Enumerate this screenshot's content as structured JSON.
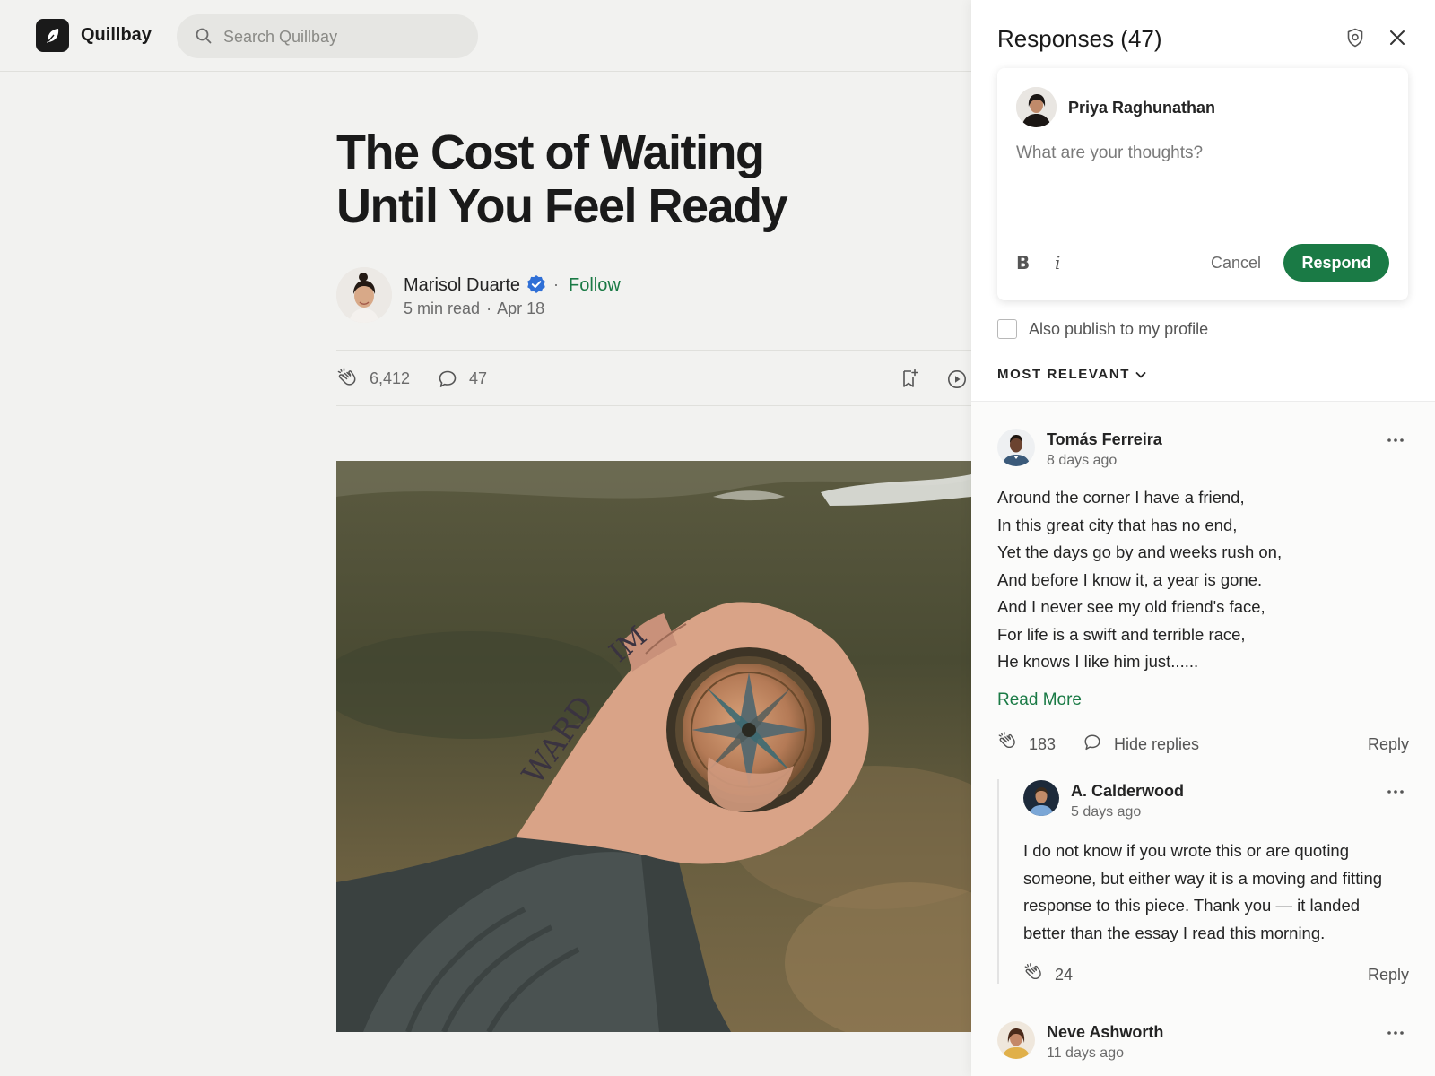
{
  "app": {
    "name": "Quillbay"
  },
  "search": {
    "placeholder": "Search Quillbay"
  },
  "article": {
    "title_lines": [
      "The Cost of Waiting",
      "Until You Feel Ready"
    ],
    "author": "Marisol Duarte",
    "follow_label": "Follow",
    "dot": "·",
    "read_time": "5 min read",
    "date": "Apr 18",
    "claps": "6,412",
    "comments": "47"
  },
  "responses_panel": {
    "title": "Responses (47)",
    "composer": {
      "user_name": "Priya Raghunathan",
      "placeholder": "What are your thoughts?",
      "bold_label": "B",
      "italic_label": "i",
      "cancel_label": "Cancel",
      "respond_label": "Respond"
    },
    "publish_label": "Also publish to my profile",
    "sort_label": "MOST RELEVANT",
    "responses": [
      {
        "name": "Tomás Ferreira",
        "time": "8 days ago",
        "body_lines": [
          "Around the corner I have a friend,",
          "In this great city that has no end,",
          "Yet the days go by and weeks rush on,",
          "And before I know it, a year is gone.",
          "And I never see my old friend's face,",
          "For life is a swift and terrible race,",
          "He knows I like him just......"
        ],
        "read_more": "Read More",
        "claps": "183",
        "hide_replies": "Hide replies",
        "reply": "Reply",
        "replies": [
          {
            "name": "A. Calderwood",
            "time": "5 days ago",
            "body_lines": [
              "I do not know if you wrote this or are quoting",
              "someone, but either way it is a moving and fitting",
              "response to this piece. Thank you — it landed",
              "better than the essay I read this morning."
            ],
            "claps": "24",
            "reply": "Reply"
          }
        ]
      },
      {
        "name": "Neve Ashworth",
        "time": "11 days ago"
      }
    ]
  },
  "colors": {
    "accent_green": "#1a7a45",
    "verified_blue": "#2f6fd6",
    "background": "#f2f2f0"
  }
}
